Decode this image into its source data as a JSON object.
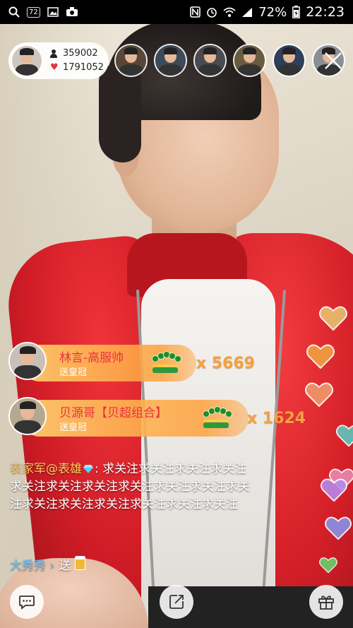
{
  "status_bar": {
    "battery_percent": "72%",
    "time": "22:23",
    "notification_badge": "72",
    "icons": [
      "search-icon",
      "notification-badge",
      "image-icon",
      "camera-icon",
      "nfc-icon",
      "alarm-icon",
      "wifi-icon",
      "signal-icon",
      "battery-icon"
    ]
  },
  "host": {
    "followers": "359002",
    "likes": "1791052"
  },
  "viewers": [
    {
      "name": "viewer-1",
      "palette": "#5a4636"
    },
    {
      "name": "viewer-2",
      "palette": "#3c4a5a"
    },
    {
      "name": "viewer-3",
      "palette": "#4a4a50"
    },
    {
      "name": "viewer-4",
      "palette": "#6a5a40"
    },
    {
      "name": "viewer-5",
      "palette": "#2d3f5a"
    },
    {
      "name": "viewer-6",
      "palette": "#8a8f95"
    }
  ],
  "gifts": [
    {
      "sender": "林言-高服帅",
      "action": "送皇冠",
      "count": "x 5669"
    },
    {
      "sender": "贝源哥【贝超组合】",
      "action": "送皇冠",
      "count": "x 1624"
    }
  ],
  "chat": {
    "message1_user": "表家军@表雄",
    "message1_text": ": 求关注求关注求关注求关注求关注求关注求关注求关注求关注求关注求关注求关注求关注求关注求关注求关注求关注",
    "message2_user": "大秀秀 ›",
    "message2_text": "送"
  },
  "colors": {
    "accent_red": "#e8323c",
    "gift_gold": "#f5a142",
    "chat_user": "#ffcd5a"
  },
  "hearts": [
    {
      "color": "#e8c070"
    },
    {
      "color": "#f0a040"
    },
    {
      "color": "#f0986a"
    },
    {
      "color": "#5cc8c0"
    },
    {
      "color": "#e88ab0"
    },
    {
      "color": "#b888e8"
    },
    {
      "color": "#8a90e8"
    },
    {
      "color": "#6ad06a"
    }
  ],
  "bottom_bar": {
    "chat_icon": "chat-bubble-icon",
    "share_icon": "share-icon",
    "gift_icon": "gift-box-icon"
  }
}
